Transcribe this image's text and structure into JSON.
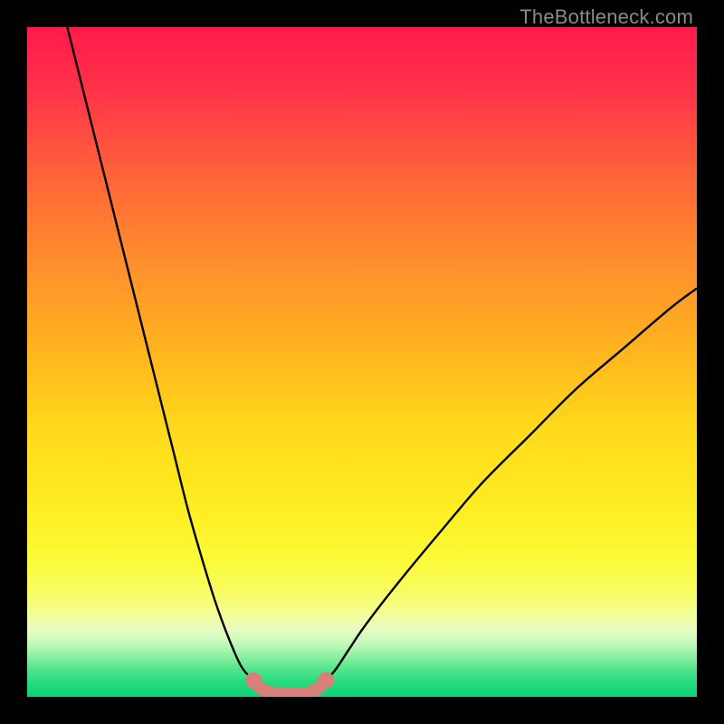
{
  "watermark": "TheBottleneck.com",
  "chart_data": {
    "type": "line",
    "title": "",
    "xlabel": "",
    "ylabel": "",
    "xlim": [
      0,
      100
    ],
    "ylim": [
      0,
      100
    ],
    "grid": false,
    "series": [
      {
        "name": "left-curve",
        "x": [
          6,
          8,
          10,
          12,
          14,
          16,
          18,
          20,
          22,
          24,
          26,
          28,
          30,
          32,
          33.8
        ],
        "y": [
          100,
          92,
          84,
          76,
          68,
          60,
          52,
          44,
          36,
          28,
          21,
          14.5,
          9,
          4.5,
          2.5
        ]
      },
      {
        "name": "right-curve",
        "x": [
          44.6,
          46,
          48,
          50,
          53,
          57,
          62,
          68,
          75,
          82,
          89,
          96,
          100
        ],
        "y": [
          2.5,
          4,
          7,
          10,
          14,
          19,
          25,
          32,
          39,
          46,
          52,
          58,
          61
        ]
      },
      {
        "name": "optimal-band",
        "x": [
          33.8,
          35,
          36.5,
          38,
          40,
          42,
          43.3,
          44.6
        ],
        "y": [
          2.5,
          1.2,
          0.6,
          0.4,
          0.4,
          0.6,
          1.2,
          2.5
        ]
      }
    ],
    "annotations": [],
    "background": "rainbow-vertical-gradient",
    "colors": {
      "curve": "#000000",
      "band": "#d97f7a"
    }
  }
}
